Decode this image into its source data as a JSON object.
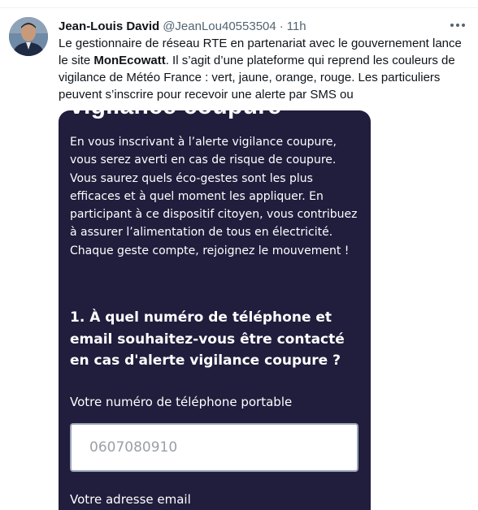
{
  "tweet": {
    "author_name": "Jean-Louis David",
    "handle": "@JeanLou40553504",
    "separator": "·",
    "time": "11h",
    "more_icon": "more-horizontal-icon",
    "text_part1": "Le gestionnaire de réseau RTE en partenariat avec le gouvernement lance le site ",
    "text_bold": "MonEcowatt",
    "text_part2": ". Il s’agit d’une plateforme qui reprend les couleurs de vigilance de Météo France : vert, jaune, orange, rouge. Les particuliers peuvent s’inscrire pour recevoir une alerte par SMS ou"
  },
  "media": {
    "clipped_title": "vigilance coupure",
    "description": "En vous inscrivant à l’alerte vigilance coupure, vous serez averti en cas de risque de coupure. Vous saurez quels éco-gestes sont les plus efficaces et à quel moment les appliquer. En participant à ce dispositif citoyen, vous contribuez à assurer l’alimentation de tous en électricité. Chaque geste compte, rejoignez le mouvement !",
    "question": "1. À quel numéro de téléphone et email souhaitez-vous être contacté en cas d'alerte vigilance coupure ?",
    "phone_label": "Votre numéro de téléphone portable",
    "phone_placeholder": "0607080910",
    "email_label": "Votre adresse email"
  },
  "colors": {
    "media_background": "#211d3d",
    "secondary_text": "#536471",
    "primary_text": "#0f1419"
  }
}
